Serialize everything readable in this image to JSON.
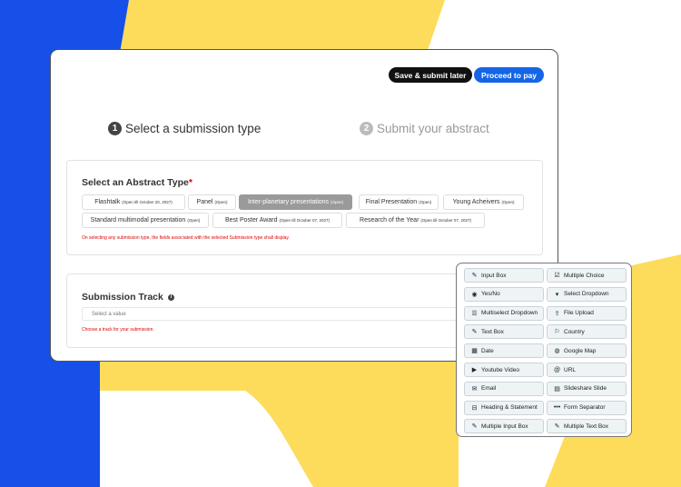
{
  "colors": {
    "blue": "#1650e8",
    "yellow": "#fddc5c",
    "pay_button": "#1565e6",
    "required": "#dd0000"
  },
  "header": {
    "save_label": "Save & submit later",
    "pay_label": "Proceed to pay"
  },
  "steps": [
    {
      "number": "1",
      "label": "Select a submission type"
    },
    {
      "number": "2",
      "label": "Submit your abstract"
    }
  ],
  "abstract_type": {
    "title": "Select an Abstract Type",
    "required_mark": "*",
    "options": [
      {
        "name": "Flashtalk",
        "status": "(Open till October 20, 2027)"
      },
      {
        "name": "Panel",
        "status": "(Open)"
      },
      {
        "name": "Inter-planetary presentations",
        "status": "(Open)",
        "selected": true
      },
      {
        "name": "Final Presentation",
        "status": "(Open)"
      },
      {
        "name": "Young Acheivers",
        "status": "(Open)"
      },
      {
        "name": "Standard multimodal presentation",
        "status": "(Open)"
      },
      {
        "name": "Best Poster Award",
        "status": "(Open till October 07, 2027)"
      },
      {
        "name": "Research of the Year",
        "status": "(Open till October 07, 2027)"
      }
    ],
    "hint": "On selecting any submission type, the fields associated with the selected Submission type shall display."
  },
  "submission_track": {
    "title": "Submission Track",
    "info_icon": "info-icon",
    "placeholder": "Select a value",
    "hint": "Choose a track for your submission."
  },
  "palette": {
    "items": [
      {
        "label": "Input Box",
        "icon": "edit-icon",
        "glyph": "✎"
      },
      {
        "label": "Multiple Choice",
        "icon": "checkbox-icon",
        "glyph": "☑"
      },
      {
        "label": "Yes/No",
        "icon": "radio-icon",
        "glyph": "◉"
      },
      {
        "label": "Select Dropdown",
        "icon": "caret-down-icon",
        "glyph": "▾"
      },
      {
        "label": "Multiselect Dropdown",
        "icon": "list-icon",
        "glyph": "☰"
      },
      {
        "label": "File Upload",
        "icon": "upload-icon",
        "glyph": "⇪"
      },
      {
        "label": "Text Box",
        "icon": "edit-icon",
        "glyph": "✎"
      },
      {
        "label": "Country",
        "icon": "flag-icon",
        "glyph": "⚐"
      },
      {
        "label": "Date",
        "icon": "calendar-icon",
        "glyph": "▦"
      },
      {
        "label": "Google Map",
        "icon": "globe-icon",
        "glyph": "◍"
      },
      {
        "label": "Youtube Video",
        "icon": "video-icon",
        "glyph": "▶"
      },
      {
        "label": "URL",
        "icon": "at-icon",
        "glyph": "@"
      },
      {
        "label": "Email",
        "icon": "envelope-icon",
        "glyph": "✉"
      },
      {
        "label": "Slideshare Slide",
        "icon": "slides-icon",
        "glyph": "▤"
      },
      {
        "label": "Heading & Statement",
        "icon": "heading-icon",
        "glyph": "⊟"
      },
      {
        "label": "Form Separator",
        "icon": "ellipsis-icon",
        "glyph": "•••"
      },
      {
        "label": "Multiple Input Box",
        "icon": "edit-icon",
        "glyph": "✎"
      },
      {
        "label": "Multiple Text Box",
        "icon": "edit-icon",
        "glyph": "✎"
      }
    ]
  }
}
